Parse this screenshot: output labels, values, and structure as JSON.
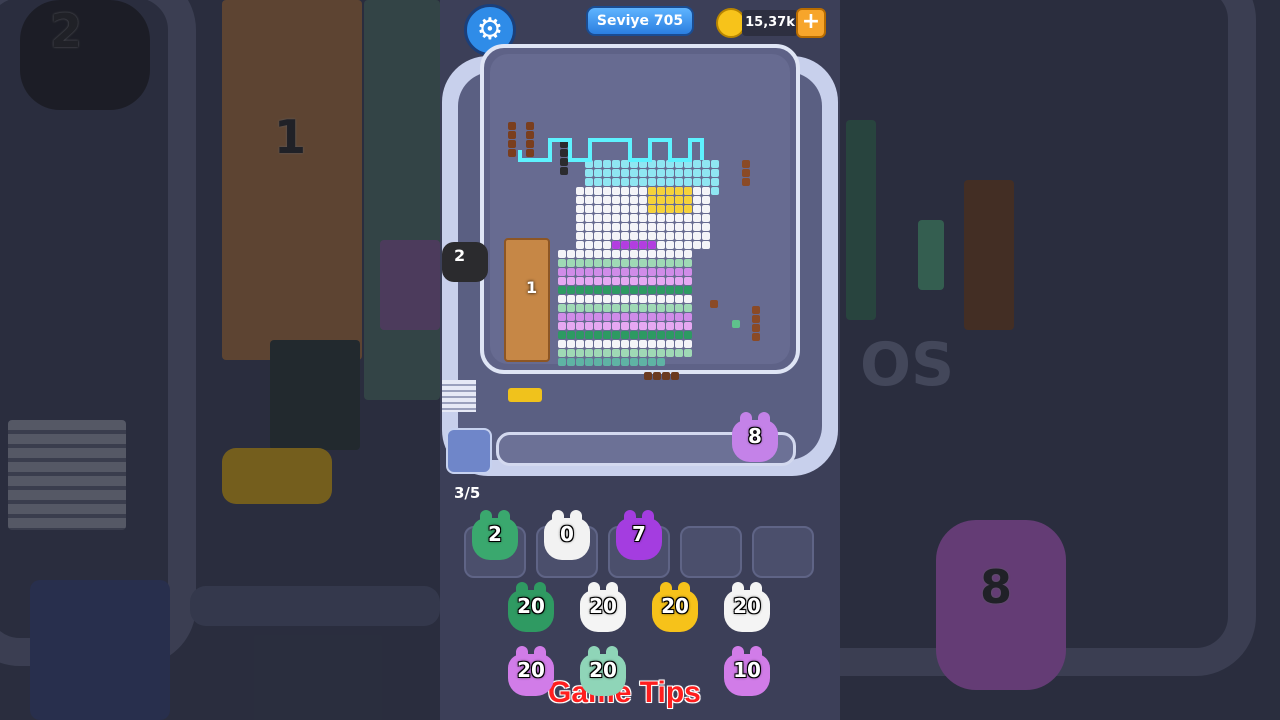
{
  "header": {
    "level_label": "Seviye 705",
    "coins": "15,37k",
    "plus_label": "+",
    "settings_icon": "gear-icon"
  },
  "board": {
    "wall_character_count": "2",
    "crate_count": "1",
    "conveyor_character_count": "8",
    "stash_count": "3/5"
  },
  "slots": [
    {
      "count": "2",
      "color": "#3aa86e"
    },
    {
      "count": "0",
      "color": "#f2f2f2"
    },
    {
      "count": "7",
      "color": "#a43de0"
    }
  ],
  "queue": [
    {
      "count": "20",
      "color": "#2f9a62"
    },
    {
      "count": "20",
      "color": "#f4f4f4"
    },
    {
      "count": "20",
      "color": "#f6c21a"
    },
    {
      "count": "20",
      "color": "#f4f4f4"
    },
    {
      "count": "20",
      "color": "#d17ce8"
    },
    {
      "count": "20",
      "color": "#8fd5b8"
    },
    {
      "count": "10",
      "color": "#d17ce8"
    }
  ],
  "background": {
    "left_number": "2",
    "left_crate_number": "1",
    "right_number": "8",
    "right_watermark": "OS"
  },
  "watermark": "Game Tips",
  "colors": {
    "accent_blue": "#2f8ce8",
    "coin_gold": "#f7c31a",
    "track_light": "#c8d0ec",
    "track_dark": "#5a5f82"
  }
}
